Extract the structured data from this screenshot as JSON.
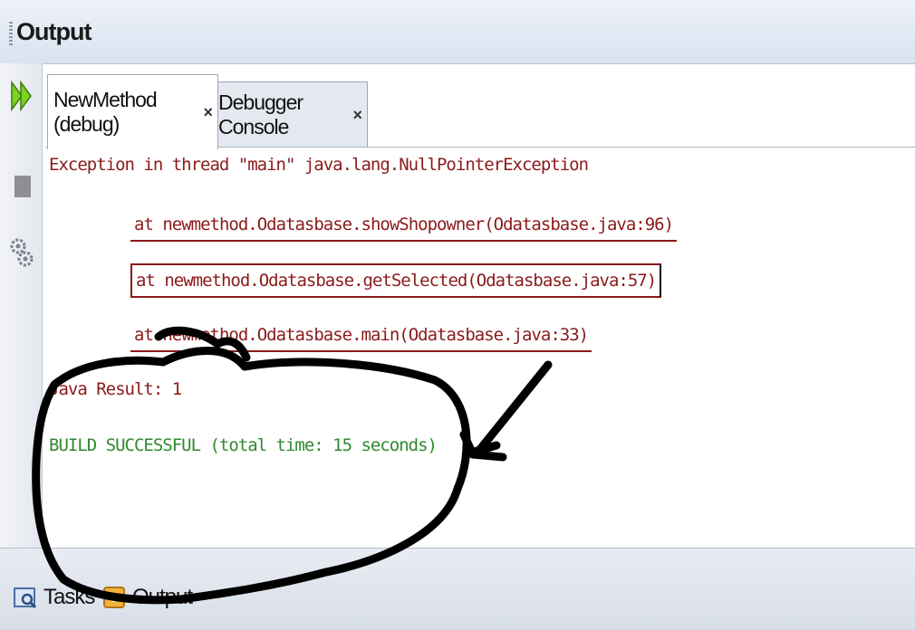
{
  "panel": {
    "title": "Output"
  },
  "tabs": [
    {
      "label": "NewMethod (debug)",
      "close": "×"
    },
    {
      "label": "Debugger Console",
      "close": "×"
    }
  ],
  "output": {
    "exception": "Exception in thread \"main\" java.lang.NullPointerException",
    "trace": [
      "at newmethod.Odatasbase.showShopowner(Odatasbase.java:96)",
      "at newmethod.Odatasbase.getSelected(Odatasbase.java:57)",
      "at newmethod.Odatasbase.main(Odatasbase.java:33)"
    ],
    "result": "Java Result: 1",
    "build": "BUILD SUCCESSFUL (total time: 15 seconds)"
  },
  "bottom": {
    "tasks": "Tasks",
    "output": "Output"
  },
  "colors": {
    "error": "#8b1a1a",
    "success": "#2f8a2f",
    "annotation": "#000000"
  },
  "icons": [
    "rerun-icon",
    "stop-icon",
    "settings-icon",
    "tasks-icon",
    "output-icon"
  ]
}
